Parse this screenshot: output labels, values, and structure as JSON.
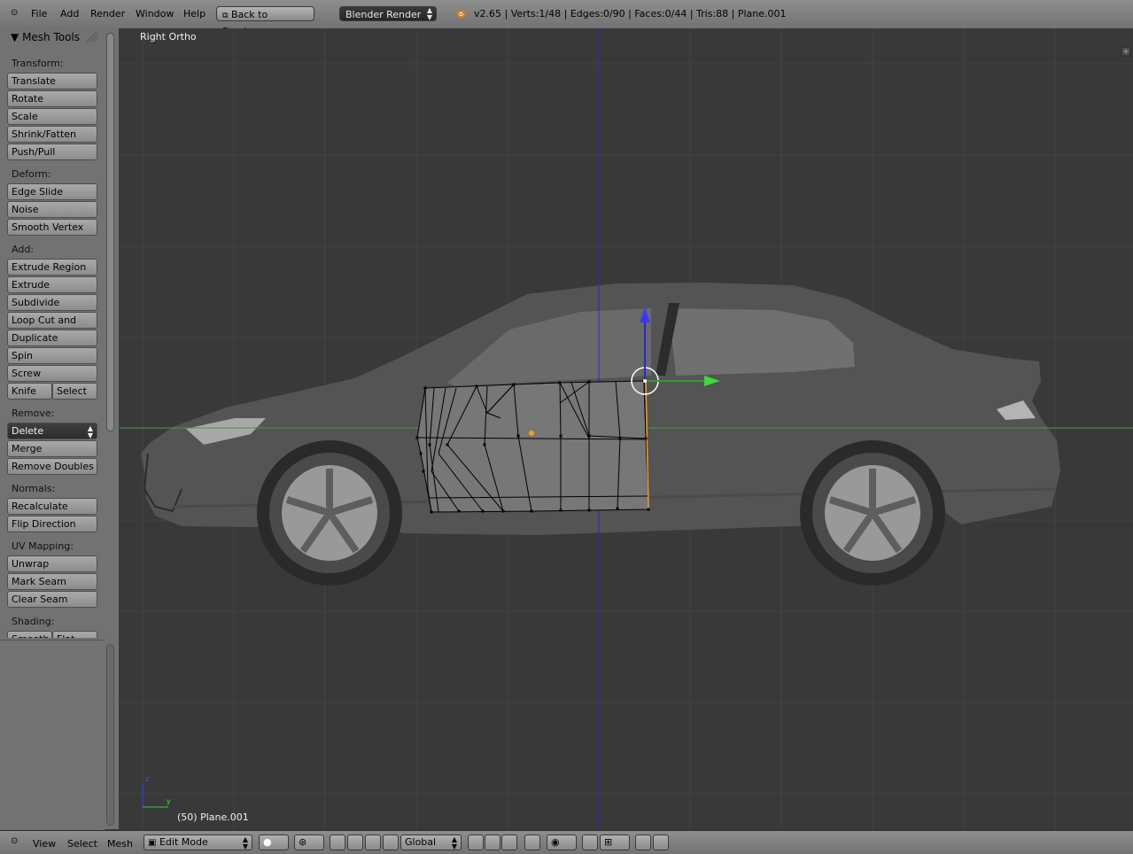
{
  "topbar": {
    "menus": [
      "File",
      "Add",
      "Render",
      "Window",
      "Help"
    ],
    "back_button": "Back to Previous",
    "render_engine": "Blender Render",
    "stats": "v2.65 | Verts:1/48 | Edges:0/90 | Faces:0/44 | Tris:88 | Plane.001"
  },
  "toolshelf": {
    "title": "Mesh Tools",
    "sections": {
      "transform": "Transform:",
      "deform": "Deform:",
      "add": "Add:",
      "remove": "Remove:",
      "normals": "Normals:",
      "uv": "UV Mapping:",
      "shading": "Shading:"
    },
    "buttons": {
      "translate": "Translate",
      "rotate": "Rotate",
      "scale": "Scale",
      "shrink": "Shrink/Fatten",
      "push": "Push/Pull",
      "edge_slide": "Edge Slide",
      "noise": "Noise",
      "smooth_vertex": "Smooth Vertex",
      "extrude_region": "Extrude Region",
      "extrude_individual": "Extrude Individual",
      "subdivide": "Subdivide",
      "loop_cut": "Loop Cut and Slide",
      "duplicate": "Duplicate",
      "spin": "Spin",
      "screw": "Screw",
      "knife": "Knife",
      "select": "Select",
      "delete": "Delete",
      "merge": "Merge",
      "remove_doubles": "Remove Doubles",
      "recalculate": "Recalculate",
      "flip_direction": "Flip Direction",
      "unwrap": "Unwrap",
      "mark_seam": "Mark Seam",
      "clear_seam": "Clear Seam",
      "smooth": "Smooth",
      "flat": "Flat"
    }
  },
  "viewport": {
    "view_label": "Right Ortho",
    "object_label": "(50) Plane.001",
    "axis_z": "z",
    "axis_y": "y"
  },
  "bottombar": {
    "menus": [
      "View",
      "Select",
      "Mesh"
    ],
    "mode": "Edit Mode",
    "orientation": "Global"
  },
  "colors": {
    "grid_bg": "#393939",
    "x_axis_green": "#3a9c3a",
    "z_axis_blue": "#2a2acc",
    "selected_orange": "#f0a020"
  }
}
